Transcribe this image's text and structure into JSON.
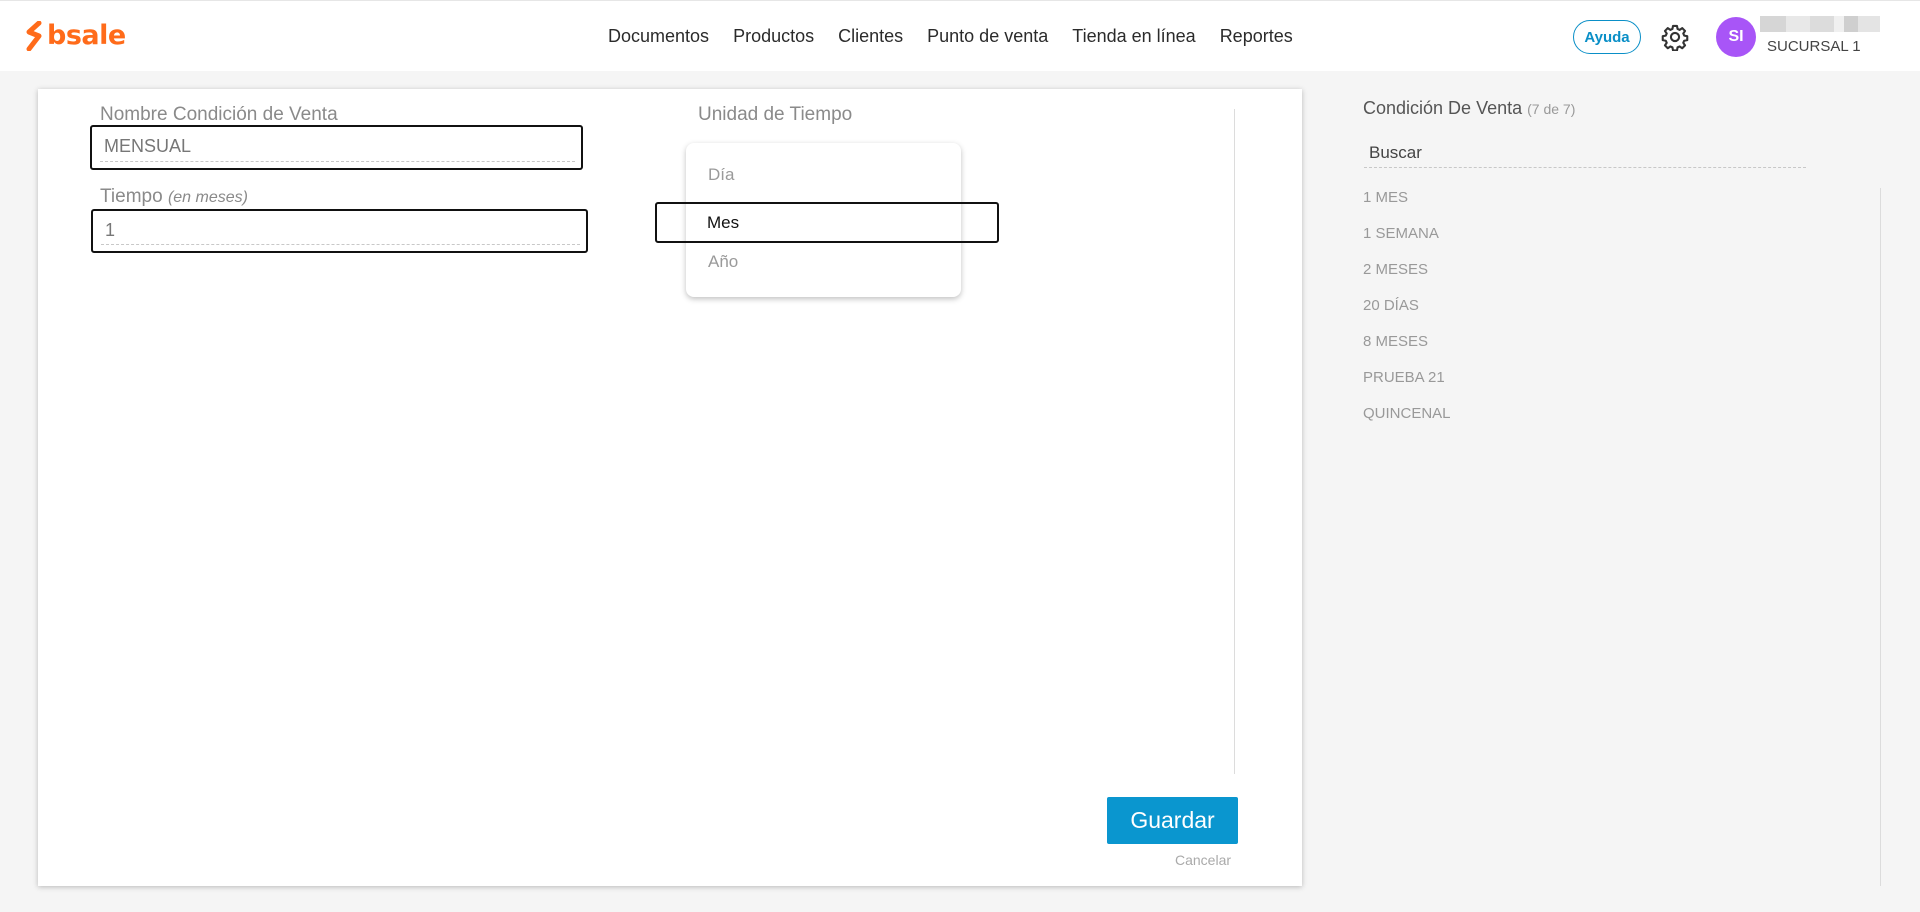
{
  "brand": {
    "name": "bsale",
    "color": "#ff6b1a"
  },
  "nav": {
    "items": [
      {
        "label": "Documentos"
      },
      {
        "label": "Productos"
      },
      {
        "label": "Clientes"
      },
      {
        "label": "Punto de venta"
      },
      {
        "label": "Tienda en línea"
      },
      {
        "label": "Reportes"
      }
    ]
  },
  "header": {
    "help_label": "Ayuda",
    "settings_icon": "gear-icon",
    "avatar_initials": "SI",
    "branch": "SUCURSAL 1"
  },
  "form": {
    "name_label": "Nombre Condición de Venta",
    "name_value": "MENSUAL",
    "time_label": "Tiempo",
    "time_hint": "(en meses)",
    "time_value": "1",
    "unit_label": "Unidad de Tiempo",
    "unit_options": [
      {
        "label": "Día"
      },
      {
        "label": "Mes"
      },
      {
        "label": "Año"
      }
    ],
    "unit_selected": "Mes",
    "save_label": "Guardar",
    "cancel_label": "Cancelar"
  },
  "panel": {
    "title": "Condición De Venta",
    "count": "(7 de 7)",
    "search_placeholder": "Buscar",
    "items": [
      {
        "label": "1 MES"
      },
      {
        "label": "1 SEMANA"
      },
      {
        "label": "2 MESES"
      },
      {
        "label": "20 DÍAS"
      },
      {
        "label": "8 MESES"
      },
      {
        "label": "PRUEBA 21"
      },
      {
        "label": "QUINCENAL"
      }
    ]
  },
  "colors": {
    "accent": "#0a96cf",
    "avatar": "#a855f7",
    "help": "#0a8fc7"
  }
}
